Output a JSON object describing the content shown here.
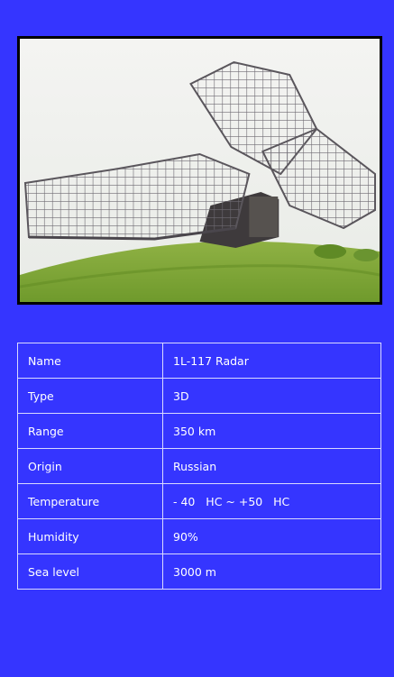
{
  "photo": {
    "subject": "radar-antenna-photo"
  },
  "specs": [
    {
      "label": "Name",
      "value": "1L-117 Radar"
    },
    {
      "label": "Type",
      "value": "3D"
    },
    {
      "label": "Range",
      "value": "350 km"
    },
    {
      "label": "Origin",
      "value": "Russian"
    },
    {
      "label": "Temperature",
      "value": "- 40   HC ~ +50   HC"
    },
    {
      "label": "Humidity",
      "value": "90%"
    },
    {
      "label": "Sea level",
      "value": "3000 m"
    }
  ],
  "colors": {
    "background": "#3535ff",
    "grid": "#d9d9ff",
    "text": "#ffffff"
  }
}
